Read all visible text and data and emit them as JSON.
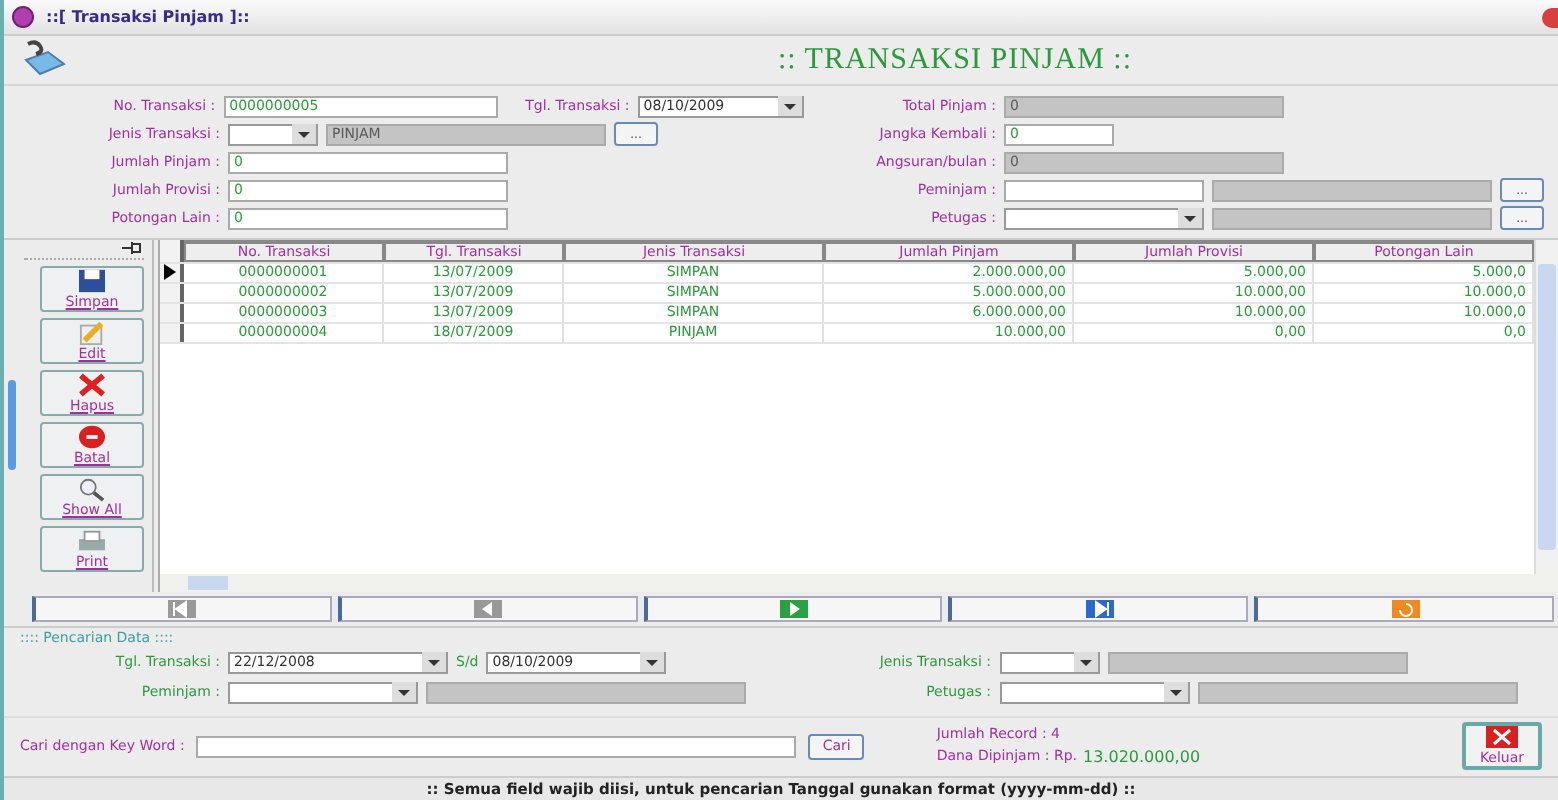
{
  "window": {
    "title": "::[ Transaksi Pinjam ]::"
  },
  "header": {
    "title": ":: TRANSAKSI PINJAM ::"
  },
  "form": {
    "left": [
      {
        "label": "No. Transaksi :",
        "parts": [
          {
            "kind": "input",
            "value": "0000000005",
            "disabled": false
          },
          {
            "kind": "label",
            "value": "Tgl. Transaksi :"
          },
          {
            "kind": "combo",
            "value": "08/10/2009"
          }
        ]
      },
      {
        "label": "Jenis Transaksi :",
        "parts": [
          {
            "kind": "combo"
          },
          {
            "kind": "input",
            "value": "PINJAM",
            "disabled": true
          },
          {
            "kind": "button",
            "value": "..."
          }
        ]
      },
      {
        "label": "Jumlah Pinjam :",
        "parts": [
          {
            "kind": "input",
            "value": "0",
            "disabled": false
          }
        ]
      },
      {
        "label": "Jumlah Provisi :",
        "parts": [
          {
            "kind": "input",
            "value": "0",
            "disabled": false
          }
        ]
      },
      {
        "label": "Potongan Lain :",
        "parts": [
          {
            "kind": "input",
            "value": "0",
            "disabled": false
          }
        ]
      }
    ],
    "right": [
      {
        "label": "Total Pinjam :",
        "parts": [
          {
            "kind": "input",
            "value": "0",
            "disabled": true
          }
        ]
      },
      {
        "label": "Jangka Kembali :",
        "parts": [
          {
            "kind": "input",
            "value": "0",
            "disabled": false
          }
        ]
      },
      {
        "label": "Angsuran/bulan :",
        "parts": [
          {
            "kind": "input",
            "value": "0",
            "disabled": true
          }
        ]
      },
      {
        "label": "Peminjam :",
        "parts": [
          {
            "kind": "input",
            "disabled": false
          },
          {
            "kind": "input",
            "disabled": true
          },
          {
            "kind": "button",
            "value": "..."
          }
        ]
      },
      {
        "label": "Petugas :",
        "parts": [
          {
            "kind": "combo"
          },
          {
            "kind": "input",
            "disabled": true
          },
          {
            "kind": "button",
            "value": "..."
          }
        ]
      }
    ]
  },
  "actions": [
    {
      "label": "Simpan",
      "kind": "save"
    },
    {
      "label": "Edit",
      "kind": "edit"
    },
    {
      "label": "Hapus",
      "kind": "delete"
    },
    {
      "label": "Batal",
      "kind": "cancel"
    },
    {
      "label": "Show All",
      "kind": "search"
    },
    {
      "label": "Print",
      "kind": "print"
    }
  ],
  "table": {
    "columns": [
      "No. Transaksi",
      "Tgl. Transaksi",
      "Jenis Transaksi",
      "Jumlah Pinjam",
      "Jumlah Provisi",
      "Potongan Lain"
    ],
    "rows": [
      {
        "selected": true,
        "cells": [
          "0000000001",
          "13/07/2009",
          "SIMPAN",
          "2.000.000,00",
          "5.000,00",
          "5.000,0"
        ]
      },
      {
        "selected": false,
        "cells": [
          "0000000002",
          "13/07/2009",
          "SIMPAN",
          "5.000.000,00",
          "10.000,00",
          "10.000,0"
        ]
      },
      {
        "selected": false,
        "cells": [
          "0000000003",
          "13/07/2009",
          "SIMPAN",
          "6.000.000,00",
          "10.000,00",
          "10.000,0"
        ]
      },
      {
        "selected": false,
        "cells": [
          "0000000004",
          "18/07/2009",
          "PINJAM",
          "10.000,00",
          "0,00",
          "0,0"
        ]
      }
    ]
  },
  "navigation": [
    {
      "kind": "first"
    },
    {
      "kind": "prev"
    },
    {
      "kind": "next"
    },
    {
      "kind": "last"
    },
    {
      "kind": "refresh"
    }
  ],
  "search": {
    "title": ":::: Pencarian Data ::::",
    "date_label": "Tgl. Transaksi :",
    "date_from": "22/12/2008",
    "to_label": "S/d",
    "date_to": "08/10/2009",
    "jenis_label": "Jenis Transaksi :",
    "peminjam_label": "Peminjam :",
    "petugas_label": "Petugas :",
    "keyword_label": "Cari dengan Key Word :",
    "button": "Cari"
  },
  "summary": {
    "records": "Jumlah Record : 4",
    "fund_label": "Dana Dipinjam : Rp.",
    "fund_value": "13.020.000,00"
  },
  "exit_button": "Keluar",
  "status_bar": ":: Semua field wajib diisi, untuk pencarian Tanggal gunakan format (yyyy-mm-dd) ::"
}
